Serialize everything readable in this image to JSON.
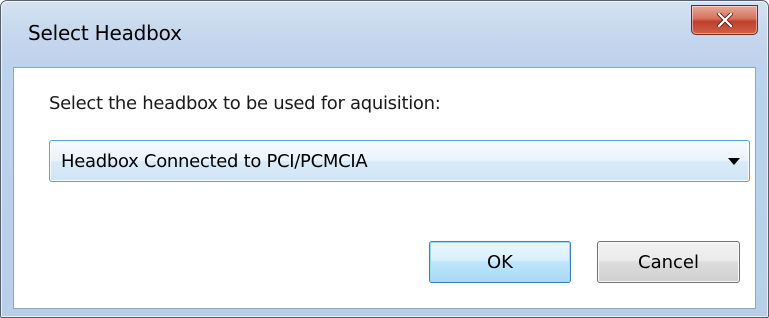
{
  "window": {
    "title": "Select Headbox",
    "close_icon": "close-x-icon"
  },
  "dialog": {
    "prompt": "Select the headbox to be used for aquisition:",
    "headbox_select": {
      "selected_value": "Headbox Connected to PCI/PCMCIA",
      "dropdown_icon": "chevron-down-icon"
    },
    "buttons": {
      "ok_label": "OK",
      "cancel_label": "Cancel"
    }
  },
  "colors": {
    "title_close": "#c7432d",
    "ok_border": "#3c7fb1",
    "combo_border": "#5aa3d9"
  }
}
